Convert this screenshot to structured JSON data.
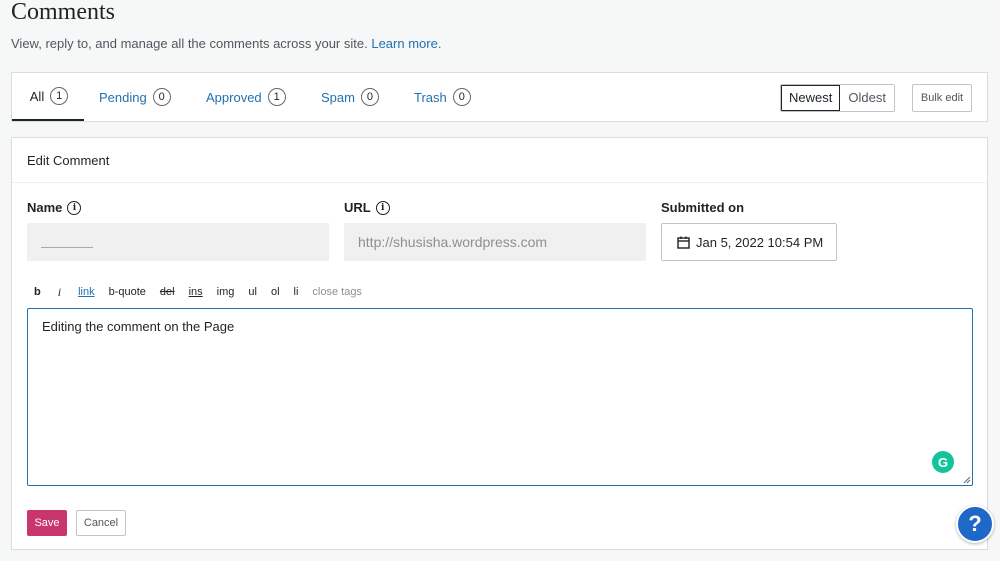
{
  "header": {
    "title": "Comments",
    "subtitle": "View, reply to, and manage all the comments across your site.",
    "learn_more": "Learn more."
  },
  "tabs": [
    {
      "label": "All",
      "count": "1"
    },
    {
      "label": "Pending",
      "count": "0"
    },
    {
      "label": "Approved",
      "count": "1"
    },
    {
      "label": "Spam",
      "count": "0"
    },
    {
      "label": "Trash",
      "count": "0"
    }
  ],
  "sort": {
    "newest": "Newest",
    "oldest": "Oldest"
  },
  "bulk_edit": "Bulk edit",
  "edit": {
    "heading": "Edit Comment",
    "name_label": "Name",
    "url_label": "URL",
    "url_placeholder": "http://shusisha.wordpress.com",
    "submitted_label": "Submitted on",
    "submitted_value": "Jan 5, 2022 10:54 PM",
    "toolbar": [
      "b",
      "i",
      "link",
      "b-quote",
      "del",
      "ins",
      "img",
      "ul",
      "ol",
      "li",
      "close tags"
    ],
    "content": "Editing the comment on the Page",
    "save": "Save",
    "cancel": "Cancel"
  },
  "colors": {
    "accent": "#2271b1",
    "save": "#c9356e",
    "grammarly": "#15c39a",
    "help": "#1e68c8"
  }
}
